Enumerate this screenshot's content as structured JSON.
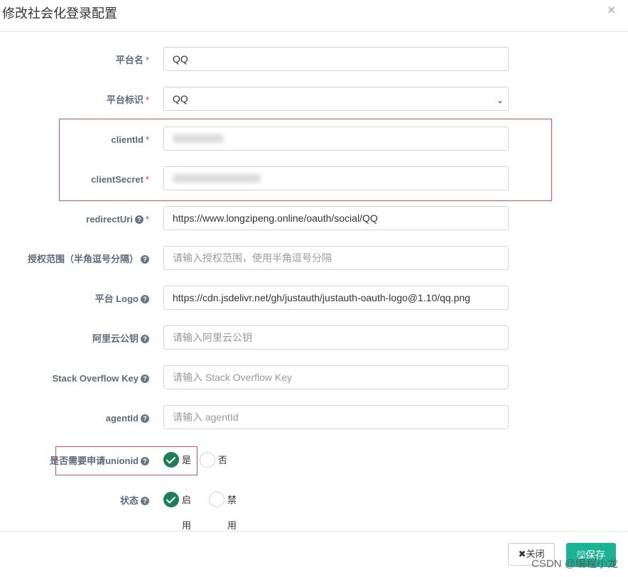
{
  "dialog": {
    "title": "修改社会化登录配置",
    "close_symbol": "×"
  },
  "fields": {
    "platform_name": {
      "label": "平台名",
      "required": "*",
      "value": "QQ"
    },
    "platform_id": {
      "label": "平台标识",
      "required": "*",
      "value": "QQ",
      "arrow": "⌄"
    },
    "client_id": {
      "label": "clientId",
      "required": "*",
      "value": ""
    },
    "client_secret": {
      "label": "clientSecret",
      "required": "*",
      "value": ""
    },
    "redirect_uri": {
      "label": "redirectUri",
      "help": "?",
      "required": "*",
      "value": "https://www.longzipeng.online/oauth/social/QQ"
    },
    "scope": {
      "label": "授权范围（半角逗号分隔）",
      "help": "?",
      "placeholder": "请输入授权范围，使用半角逗号分隔"
    },
    "logo": {
      "label": "平台 Logo",
      "help": "?",
      "value": "https://cdn.jsdelivr.net/gh/justauth/justauth-oauth-logo@1.10/qq.png"
    },
    "alipay_key": {
      "label": "阿里云公钥",
      "help": "?",
      "placeholder": "请输入阿里云公钥"
    },
    "stackoverflow_key": {
      "label": "Stack Overflow Key",
      "help": "?",
      "placeholder": "请输入 Stack Overflow Key"
    },
    "agent_id": {
      "label": "agentId",
      "help": "?",
      "placeholder": "请输入 agentId"
    },
    "unionid": {
      "label": "是否需要申请unionid",
      "help": "?",
      "options": [
        "是",
        "否"
      ],
      "selected": "是"
    },
    "status": {
      "label": "状态",
      "help": "?",
      "options": [
        "启用",
        "禁用"
      ],
      "selected": "启用"
    }
  },
  "footer": {
    "close_label": "✖关闭",
    "save_label": "🖫保存"
  },
  "watermark": "CSDN @编程小龙",
  "colors": {
    "accent": "#1bb394",
    "radio_checked": "#1e7e5a",
    "required": "#e5383b",
    "highlight_box": "#d9534f"
  }
}
